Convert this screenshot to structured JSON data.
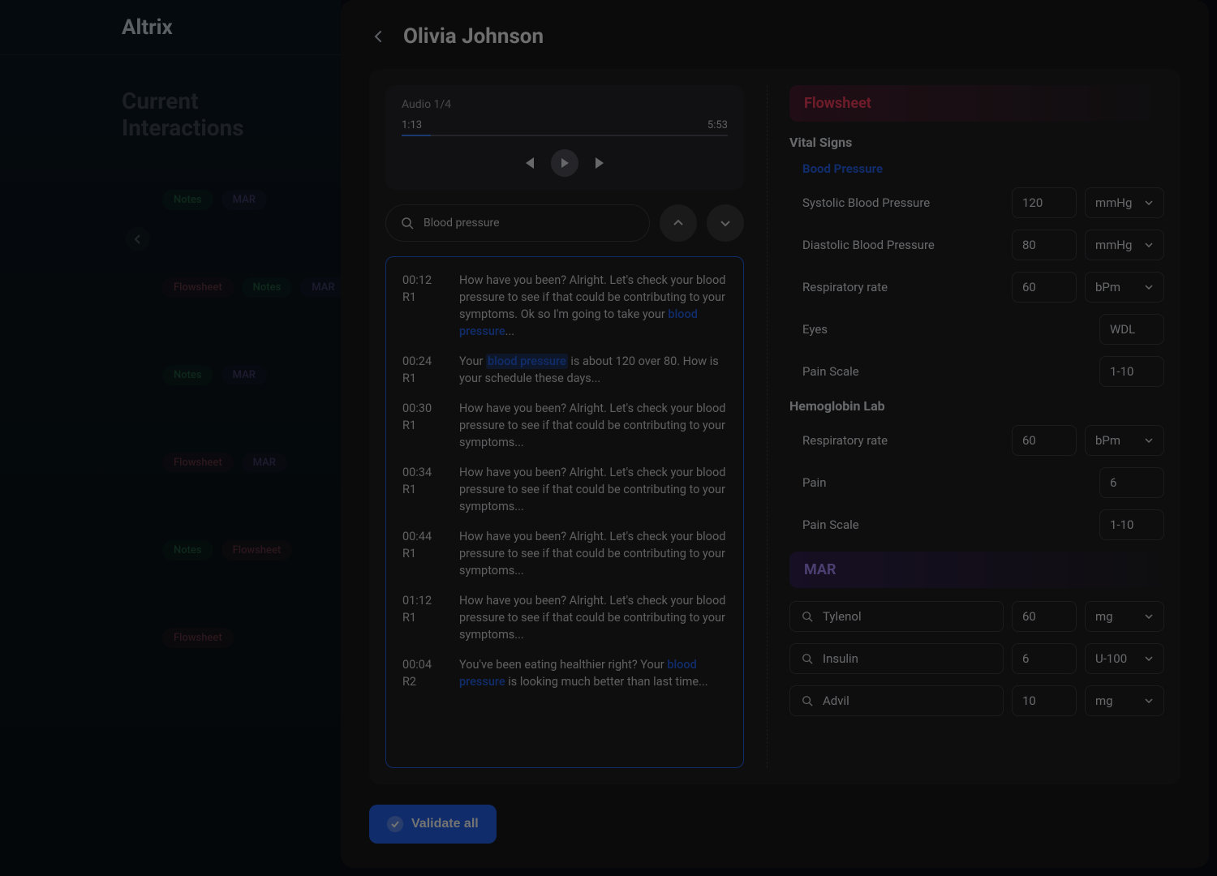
{
  "app": {
    "name": "Altrix"
  },
  "background": {
    "heading": "Current Interactions",
    "cards": [
      {
        "tags": [
          "Notes",
          "MAR"
        ]
      },
      {
        "tags": [
          "Flowsheet",
          "Notes",
          "MAR"
        ]
      },
      {
        "tags": [
          "Notes",
          "MAR"
        ]
      },
      {
        "tags": [
          "Flowsheet",
          "MAR"
        ]
      },
      {
        "tags": [
          "Notes",
          "Flowsheet"
        ]
      },
      {
        "tags": [
          "Flowsheet"
        ]
      }
    ]
  },
  "patient": {
    "name": "Olivia Johnson"
  },
  "audio": {
    "label": "Audio 1/4",
    "current": "1:13",
    "total": "5:53"
  },
  "search": {
    "value": "Blood pressure"
  },
  "transcript": [
    {
      "time": "00:12",
      "role": "R1",
      "pre": "How have you been? Alright. Let's check your blood pressure to see if that could be contributing to your symptoms. Ok so I'm going to take your ",
      "hl": "blood pressure",
      "post": "..."
    },
    {
      "time": "00:24",
      "role": "R1",
      "pre": "Your ",
      "hl": "blood pressure",
      "hlbg": true,
      "post": " is about 120 over 80. How is your schedule these days..."
    },
    {
      "time": "00:30",
      "role": "R1",
      "pre": "How have you been? Alright. Let's check your blood pressure to see if that could be contributing to your symptoms...",
      "hl": "",
      "post": ""
    },
    {
      "time": "00:34",
      "role": "R1",
      "pre": "How have you been? Alright. Let's check your blood pressure to see if that could be contributing to your symptoms...",
      "hl": "",
      "post": ""
    },
    {
      "time": "00:44",
      "role": "R1",
      "pre": "How have you been? Alright. Let's check your blood pressure to see if that could be contributing to your symptoms...",
      "hl": "",
      "post": ""
    },
    {
      "time": "01:12",
      "role": "R1",
      "pre": "How have you been? Alright. Let's check your blood pressure to see if that could be contributing to your symptoms...",
      "hl": "",
      "post": ""
    },
    {
      "time": "00:04",
      "role": "R2",
      "pre": "You've been eating healthier right? Your ",
      "hl": "blood pressure",
      "post": " is looking much better than last time..."
    }
  ],
  "flowsheet": {
    "title": "Flowsheet",
    "vitals_heading": "Vital Signs",
    "bp_heading": "Bood Pressure",
    "fields": {
      "systolic": {
        "label": "Systolic Blood Pressure",
        "value": "120",
        "unit": "mmHg"
      },
      "diastolic": {
        "label": "Diastolic Blood Pressure",
        "value": "80",
        "unit": "mmHg"
      },
      "respiratory": {
        "label": "Respiratory rate",
        "value": "60",
        "unit": "bPm"
      },
      "eyes": {
        "label": "Eyes",
        "value": "WDL"
      },
      "pain_scale": {
        "label": "Pain Scale",
        "value": "1-10"
      }
    },
    "hemoglobin_heading": "Hemoglobin Lab",
    "hemo_fields": {
      "respiratory": {
        "label": "Respiratory rate",
        "value": "60",
        "unit": "bPm"
      },
      "pain": {
        "label": "Pain",
        "value": "6"
      },
      "pain_scale": {
        "label": "Pain Scale",
        "value": "1-10"
      }
    }
  },
  "mar": {
    "title": "MAR",
    "meds": [
      {
        "name": "Tylenol",
        "dose": "60",
        "unit": "mg"
      },
      {
        "name": "Insulin",
        "dose": "6",
        "unit": "U-100"
      },
      {
        "name": "Advil",
        "dose": "10",
        "unit": "mg"
      }
    ]
  },
  "validate": {
    "label": "Validate all"
  }
}
